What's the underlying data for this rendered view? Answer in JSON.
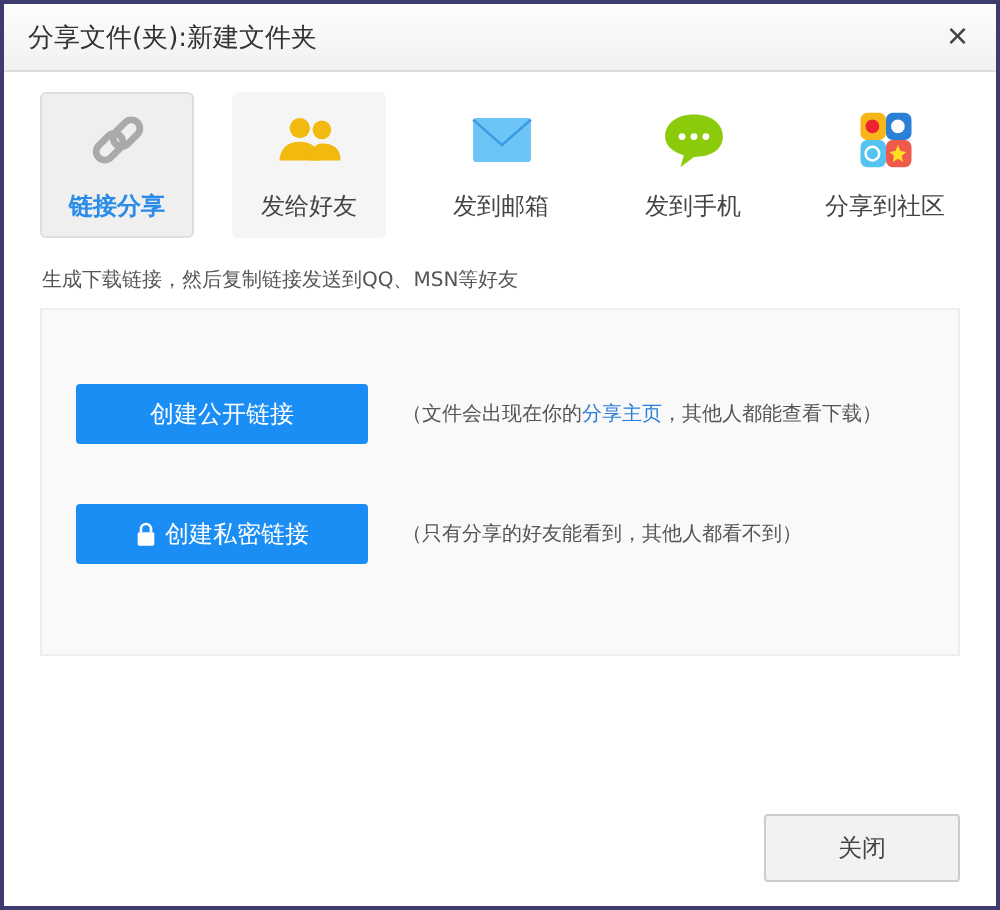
{
  "window": {
    "title": "分享文件(夹):新建文件夹",
    "close": "×"
  },
  "tabs": [
    {
      "label": "链接分享",
      "kind": "link",
      "selected": true
    },
    {
      "label": "发给好友",
      "kind": "friends",
      "selected": false
    },
    {
      "label": "发到邮箱",
      "kind": "mail",
      "selected": false
    },
    {
      "label": "发到手机",
      "kind": "phone",
      "selected": false
    },
    {
      "label": "分享到社区",
      "kind": "community",
      "selected": false
    }
  ],
  "description": "生成下载链接，然后复制链接发送到QQ、MSN等好友",
  "options": [
    {
      "button": "创建公开链接",
      "locked": false,
      "note": "（文件会出现在你的",
      "link": "分享主页",
      "note_after": "，其他人都能查看下载）"
    },
    {
      "button": "创建私密链接",
      "locked": true,
      "note": "（只有分享的好友能看到，其他人都看不到）"
    }
  ],
  "footer_button": "关闭"
}
